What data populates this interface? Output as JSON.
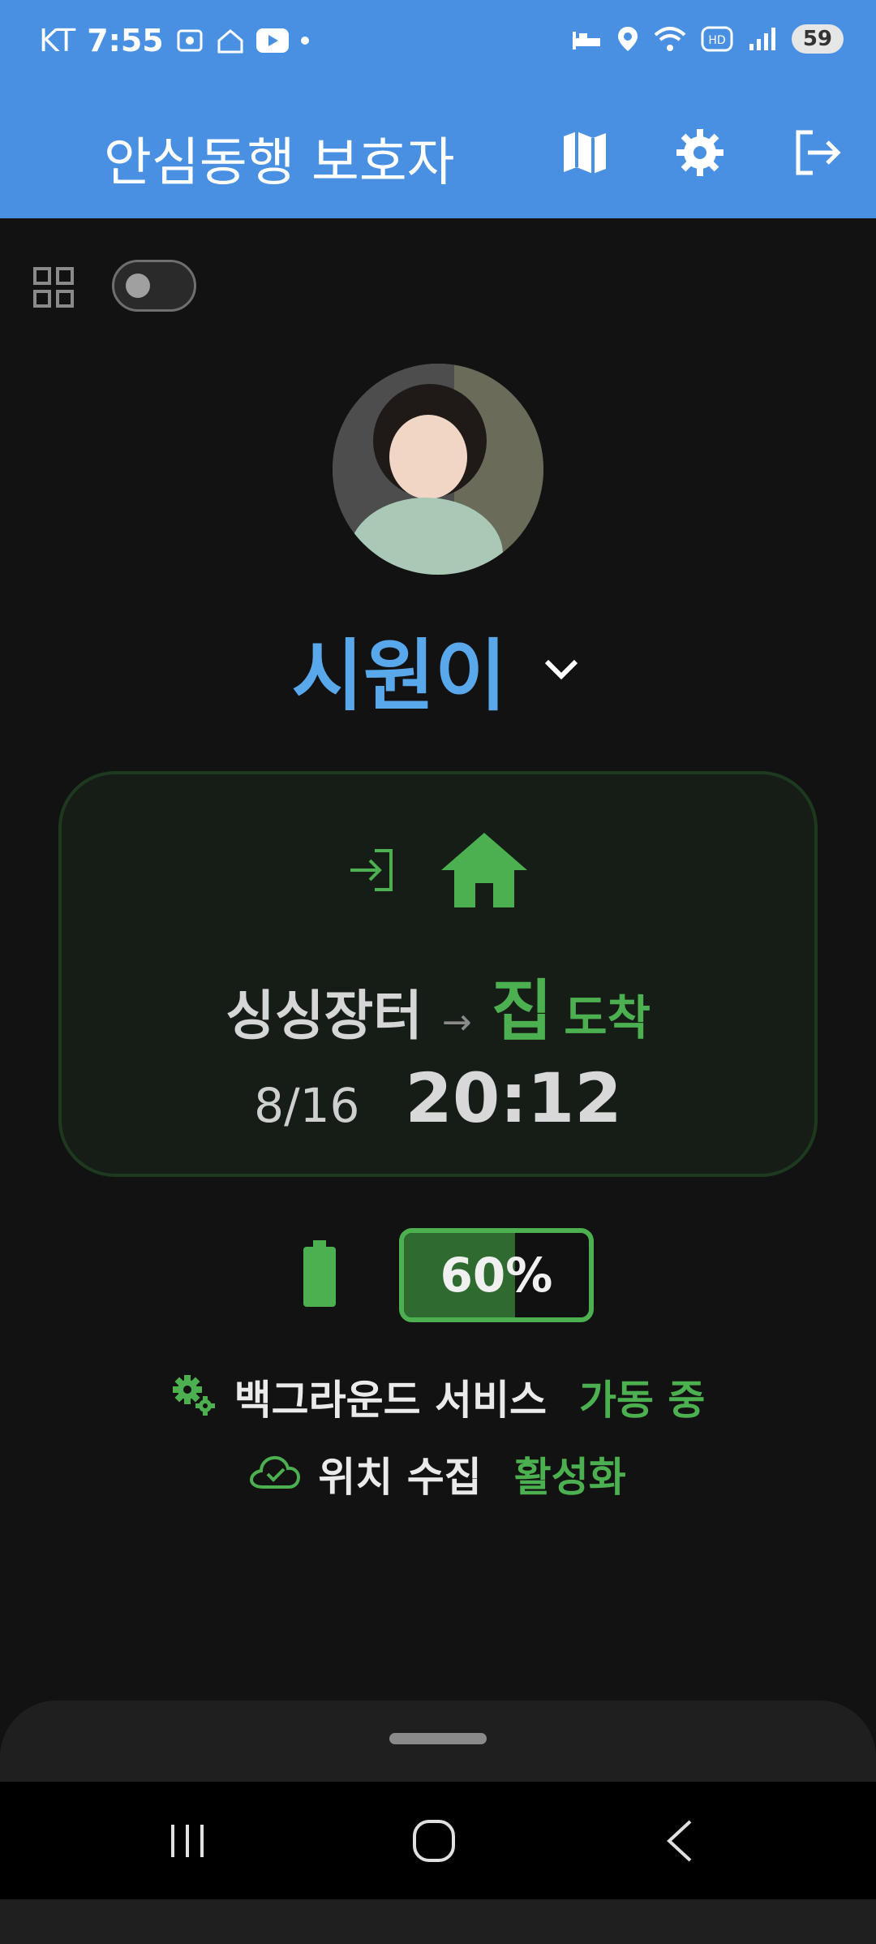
{
  "status_bar": {
    "carrier": "KT",
    "time": "7:55",
    "battery_level": "59",
    "icons": [
      "screenshot-icon",
      "home-icon",
      "youtube-icon",
      "dot-icon",
      "sleep-icon",
      "location-icon",
      "wifi-icon",
      "hd-icon",
      "signal-icon"
    ]
  },
  "app_bar": {
    "title": "안심동행 보호자",
    "actions": [
      "map-icon",
      "settings-icon",
      "logout-icon"
    ]
  },
  "toolbar": {
    "grid_icon": "grid-icon",
    "toggle_on": false
  },
  "child": {
    "name": "시원이"
  },
  "event_card": {
    "from": "싱싱장터",
    "arrow": "→",
    "to": "집",
    "status": "도착",
    "date": "8/16",
    "time": "20:12",
    "icons": [
      "enter-icon",
      "home-icon"
    ]
  },
  "battery": {
    "percent_label": "60%",
    "level": 0.6
  },
  "service": {
    "label": "백그라운드 서비스",
    "value": "가동 중"
  },
  "location": {
    "label": "위치 수집",
    "value": "활성화"
  },
  "colors": {
    "header": "#4a90e2",
    "accent_green": "#4caf50",
    "name_blue": "#5aa8ec",
    "background": "#121212"
  }
}
